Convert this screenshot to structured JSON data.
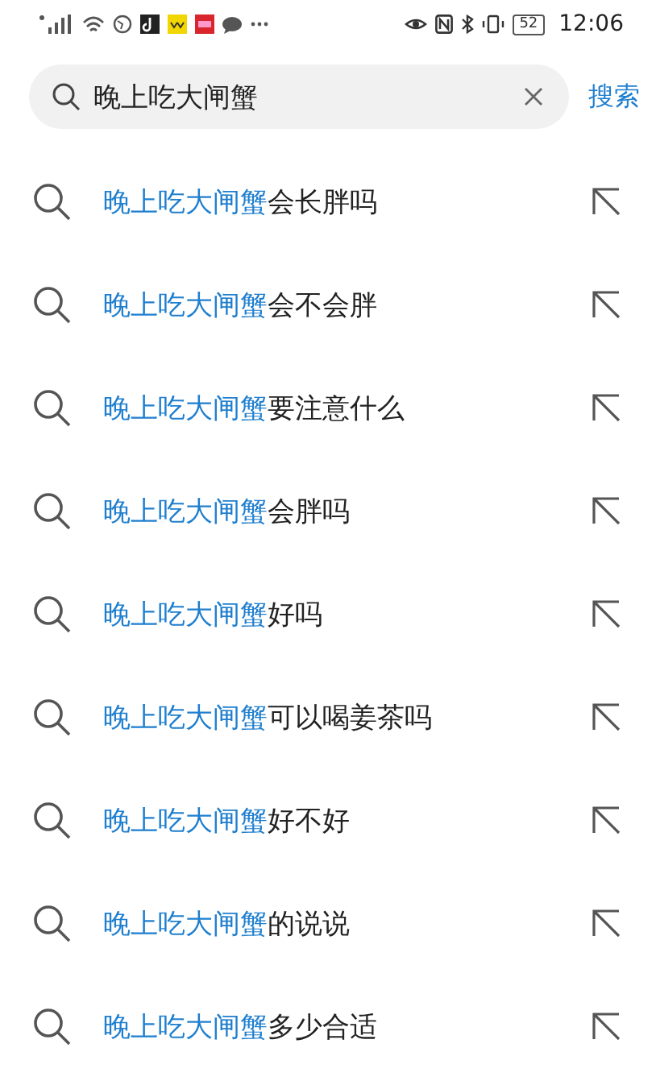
{
  "status_bar": {
    "battery": "52",
    "time": "12:06"
  },
  "search": {
    "value": "晚上吃大闸蟹",
    "button": "搜索"
  },
  "suggestions": [
    {
      "match": "晚上吃大闸蟹",
      "rest": "会长胖吗"
    },
    {
      "match": "晚上吃大闸蟹",
      "rest": "会不会胖"
    },
    {
      "match": "晚上吃大闸蟹",
      "rest": "要注意什么"
    },
    {
      "match": "晚上吃大闸蟹",
      "rest": "会胖吗"
    },
    {
      "match": "晚上吃大闸蟹",
      "rest": "好吗"
    },
    {
      "match": "晚上吃大闸蟹",
      "rest": "可以喝姜茶吗"
    },
    {
      "match": "晚上吃大闸蟹",
      "rest": "好不好"
    },
    {
      "match": "晚上吃大闸蟹",
      "rest": "的说说"
    },
    {
      "match": "晚上吃大闸蟹",
      "rest": "多少合适"
    }
  ]
}
